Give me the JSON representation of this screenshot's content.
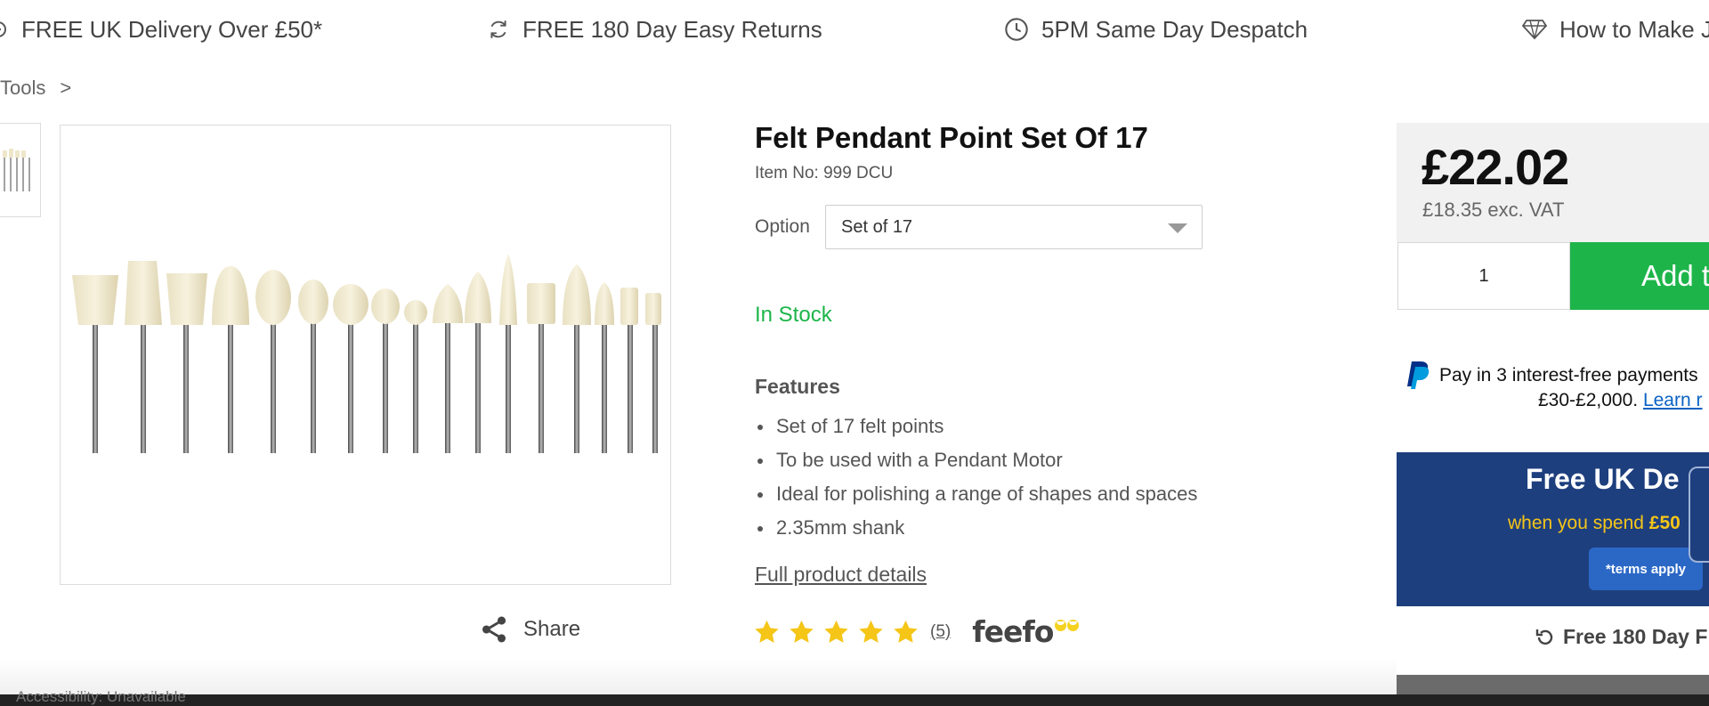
{
  "usp_bar": {
    "items": [
      {
        "icon": "truck-icon",
        "label": "FREE UK Delivery Over £50*"
      },
      {
        "icon": "refresh-icon",
        "label": "FREE 180 Day Easy Returns"
      },
      {
        "icon": "clock-icon",
        "label": "5PM Same Day Despatch"
      },
      {
        "icon": "diamond-icon",
        "label": "How to Make J"
      }
    ]
  },
  "breadcrumb": {
    "label": "Tools",
    "separator": ">"
  },
  "share": {
    "label": "Share",
    "icon": "share-icon"
  },
  "product": {
    "title": "Felt Pendant Point Set Of 17",
    "item_no": "Item No: 999 DCU",
    "option_label": "Option",
    "option_value": "Set of 17",
    "stock": "In Stock",
    "features_heading": "Features",
    "features": [
      "Set of 17 felt points",
      "To be used with a Pendant Motor",
      "Ideal for polishing a range of shapes and spaces",
      "2.35mm shank"
    ],
    "full_details_link": "Full product details",
    "rating": {
      "stars": 5,
      "count": "(5)",
      "provider": "feefo"
    }
  },
  "buy_box": {
    "price": "£22.02",
    "price_ex_vat": "£18.35 exc. VAT",
    "quantity": "1",
    "add_button": "Add t"
  },
  "paypal": {
    "line1": "Pay in 3 interest-free payments",
    "line2": "£30-£2,000.",
    "link": "Learn r"
  },
  "promo": {
    "title": "Free UK De",
    "subtitle_prefix": "when you spend ",
    "subtitle_amount": "£50",
    "terms_button": "*terms apply"
  },
  "returns": {
    "label": "Free 180 Day F"
  },
  "status_bar": {
    "text": "Accessibility: Unavailable"
  },
  "colors": {
    "accent_green": "#1db54a",
    "promo_navy": "#1e3f7e",
    "promo_yellow": "#f5c518",
    "star_yellow": "#f5c518",
    "link_blue": "#0b62c4"
  }
}
